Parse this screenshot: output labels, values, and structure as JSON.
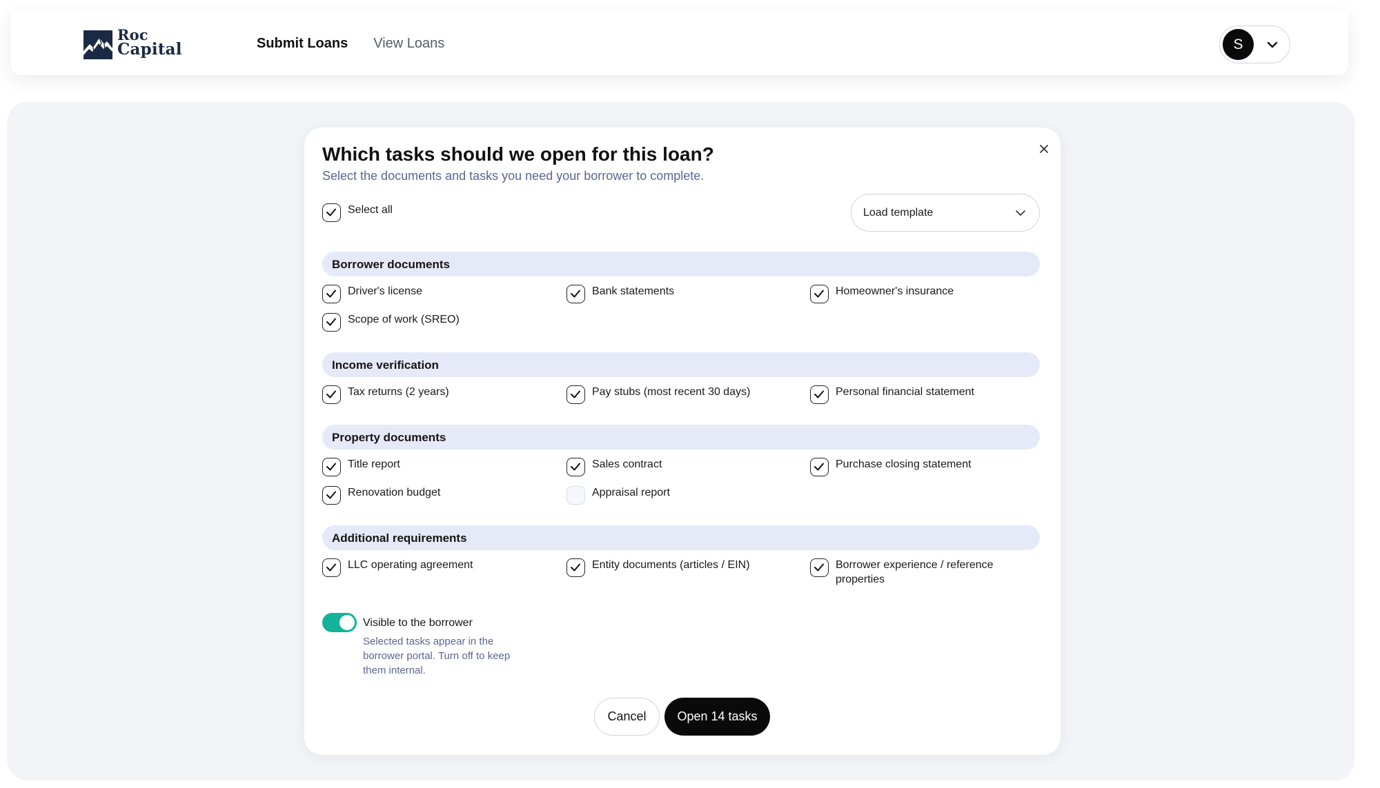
{
  "brand": {
    "name_line1": "Roc",
    "name_line2": "Capital",
    "color": "#1b2a44"
  },
  "nav": {
    "items": [
      {
        "label": "Submit Loans",
        "active": true
      },
      {
        "label": "View Loans",
        "active": false
      }
    ]
  },
  "account": {
    "avatar_initial": "S",
    "icon": "chevron-down-icon"
  },
  "modal": {
    "title": "Which tasks should we open for this loan?",
    "subtitle": "Select the documents and tasks you need your borrower to complete.",
    "close_icon": "close-icon",
    "select_all": {
      "label": "Select all",
      "checked": true
    },
    "template_select": {
      "value": "Load template",
      "icon": "chevron-down-icon"
    },
    "sections": [
      {
        "title": "Borrower documents",
        "items": [
          {
            "label": "Driver's license",
            "checked": true
          },
          {
            "label": "Bank statements",
            "checked": true
          },
          {
            "label": "Homeowner's insurance",
            "checked": true
          },
          {
            "label": "Scope of work (SREO)",
            "checked": true
          }
        ]
      },
      {
        "title": "Income verification",
        "items": [
          {
            "label": "Tax returns (2 years)",
            "checked": true
          },
          {
            "label": "Pay stubs (most recent 30 days)",
            "checked": true
          },
          {
            "label": "Personal financial statement",
            "checked": true
          }
        ]
      },
      {
        "title": "Property documents",
        "items": [
          {
            "label": "Title report",
            "checked": true
          },
          {
            "label": "Sales contract",
            "checked": true
          },
          {
            "label": "Purchase closing statement",
            "checked": true
          },
          {
            "label": "Renovation budget",
            "checked": true
          },
          {
            "label": "Appraisal report",
            "checked": false
          }
        ]
      },
      {
        "title": "Additional requirements",
        "items": [
          {
            "label": "LLC operating agreement",
            "checked": true
          },
          {
            "label": "Entity documents (articles / EIN)",
            "checked": true
          },
          {
            "label": "Borrower experience / reference properties",
            "checked": true
          }
        ]
      }
    ],
    "visibility": {
      "label": "Visible to the borrower",
      "help": "Selected tasks appear in the borrower portal. Turn off to keep them internal.",
      "on": true,
      "on_color": "#12b39a"
    },
    "actions": {
      "cancel_label": "Cancel",
      "submit_label": "Open 14 tasks"
    }
  },
  "colors": {
    "accent": "#0a0a0a",
    "section_bg": "#e6e9f7",
    "muted_text": "#5b6596",
    "page_bg": "#f3f4f7"
  }
}
